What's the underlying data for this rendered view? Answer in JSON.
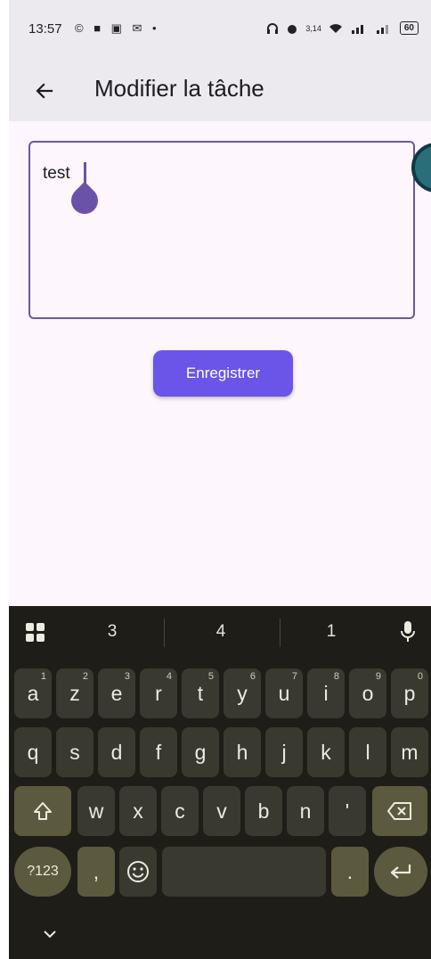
{
  "status_bar": {
    "time": "13:57",
    "left_icons": "© ■ ▣ ✉ •",
    "network_speed": "3,14",
    "battery": "60"
  },
  "app_bar": {
    "title": "Modifier la tâche"
  },
  "editor": {
    "value": "test"
  },
  "save_button": {
    "label": "Enregistrer"
  },
  "keyboard": {
    "suggestions": [
      "3",
      "4",
      "1"
    ],
    "row1": [
      {
        "k": "a",
        "h": "1"
      },
      {
        "k": "z",
        "h": "2"
      },
      {
        "k": "e",
        "h": "3"
      },
      {
        "k": "r",
        "h": "4"
      },
      {
        "k": "t",
        "h": "5"
      },
      {
        "k": "y",
        "h": "6"
      },
      {
        "k": "u",
        "h": "7"
      },
      {
        "k": "i",
        "h": "8"
      },
      {
        "k": "o",
        "h": "9"
      },
      {
        "k": "p",
        "h": "0"
      }
    ],
    "row2": [
      "q",
      "s",
      "d",
      "f",
      "g",
      "h",
      "j",
      "k",
      "l",
      "m"
    ],
    "row3": [
      "w",
      "x",
      "c",
      "v",
      "b",
      "n",
      "'"
    ],
    "symbols_label": "?123",
    "comma": ",",
    "period": "."
  },
  "colors": {
    "accent": "#6a55e8",
    "caret": "#6a52a8",
    "keyboard_bg": "#1e1d17"
  },
  "icons": [
    "back-arrow-icon",
    "apps-grid-icon",
    "microphone-icon",
    "shift-icon",
    "backspace-icon",
    "emoji-icon",
    "enter-icon",
    "keyboard-hide-icon"
  ]
}
